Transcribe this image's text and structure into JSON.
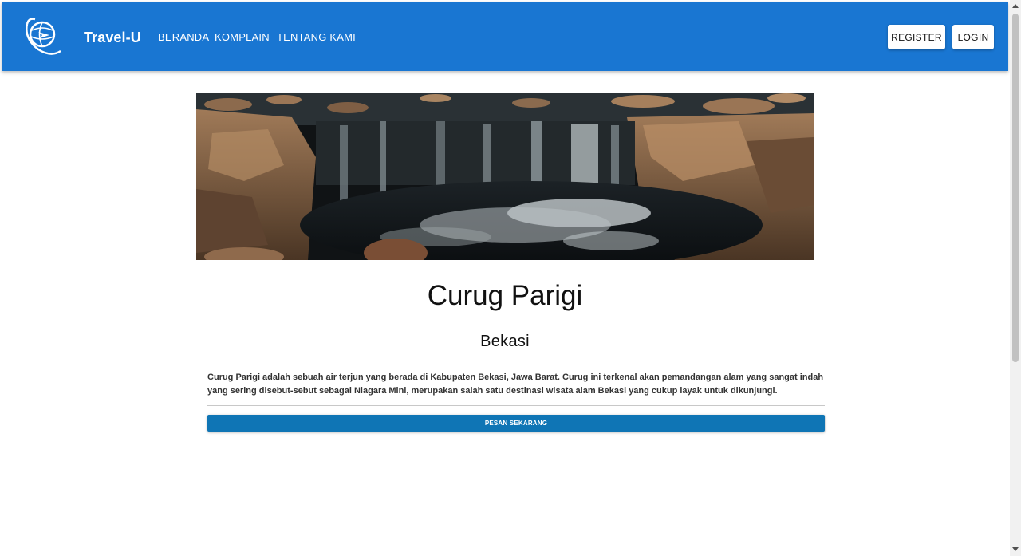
{
  "header": {
    "brand": "Travel-U",
    "nav": [
      {
        "label": "BERANDA"
      },
      {
        "label": "KOMPLAIN"
      },
      {
        "label": "TENTANG KAMI"
      }
    ],
    "register_label": "REGISTER",
    "login_label": "LOGIN",
    "logo_icon": "globe-plane-logo-icon",
    "bar_color": "#1976d2"
  },
  "destination": {
    "hero_image": "waterfall-photo",
    "name": "Curug Parigi",
    "location": "Bekasi",
    "description": "Curug Parigi adalah sebuah air terjun yang berada di Kabupaten Bekasi, Jawa Barat. Curug ini terkenal akan pemandangan alam yang sangat indah yang sering disebut-sebut sebagai Niagara Mini, merupakan salah satu destinasi wisata alam Bekasi yang cukup layak untuk dikunjungi.",
    "order_label": "PESAN SEKARANG",
    "order_color": "#0f75b5"
  }
}
